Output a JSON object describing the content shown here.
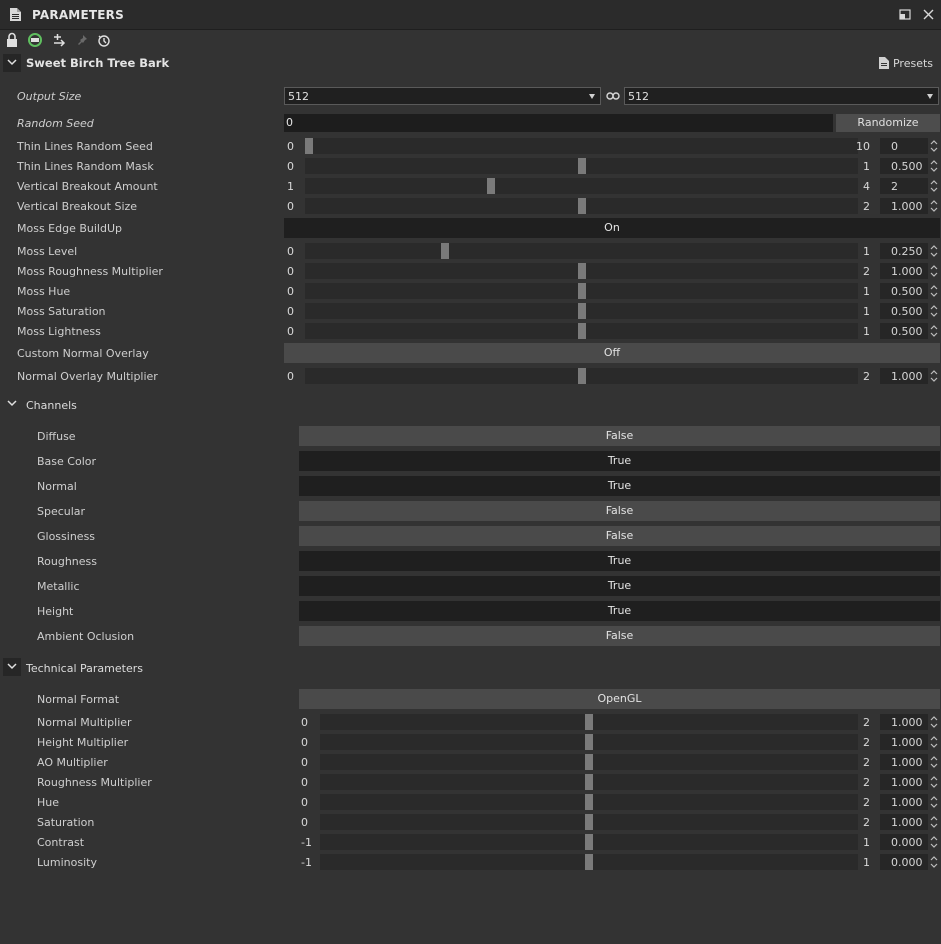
{
  "panel": {
    "title": "PARAMETERS"
  },
  "graph": {
    "title": "Sweet Birch Tree Bark",
    "presets_label": "Presets"
  },
  "output_size": {
    "label": "Output Size",
    "width": "512",
    "height": "512"
  },
  "random_seed": {
    "label": "Random Seed",
    "value": "0",
    "button": "Randomize"
  },
  "main_params": [
    {
      "label": "Thin Lines Random Seed",
      "min": "0",
      "max": "10",
      "value": "0",
      "fraction": 0.0
    },
    {
      "label": "Thin Lines Random Mask",
      "min": "0",
      "max": "1",
      "value": "0.500",
      "fraction": 0.5
    },
    {
      "label": "Vertical Breakout Amount",
      "min": "1",
      "max": "4",
      "value": "2",
      "fraction": 0.3333
    },
    {
      "label": "Vertical Breakout Size",
      "min": "0",
      "max": "2",
      "value": "1.000",
      "fraction": 0.5
    }
  ],
  "moss_edge": {
    "label": "Moss Edge BuildUp",
    "value": "On",
    "state": "on"
  },
  "moss_params": [
    {
      "label": "Moss Level",
      "min": "0",
      "max": "1",
      "value": "0.250",
      "fraction": 0.25
    },
    {
      "label": "Moss Roughness Multiplier",
      "min": "0",
      "max": "2",
      "value": "1.000",
      "fraction": 0.5
    },
    {
      "label": "Moss Hue",
      "min": "0",
      "max": "1",
      "value": "0.500",
      "fraction": 0.5
    },
    {
      "label": "Moss Saturation",
      "min": "0",
      "max": "1",
      "value": "0.500",
      "fraction": 0.5
    },
    {
      "label": "Moss Lightness",
      "min": "0",
      "max": "1",
      "value": "0.500",
      "fraction": 0.5
    }
  ],
  "custom_normal": {
    "label": "Custom Normal Overlay",
    "value": "Off",
    "state": "off"
  },
  "normal_overlay": {
    "label": "Normal Overlay Multiplier",
    "min": "0",
    "max": "2",
    "value": "1.000",
    "fraction": 0.5
  },
  "channels": {
    "title": "Channels",
    "items": [
      {
        "label": "Diffuse",
        "value": "False",
        "state": "off"
      },
      {
        "label": "Base Color",
        "value": "True",
        "state": "on"
      },
      {
        "label": "Normal",
        "value": "True",
        "state": "on"
      },
      {
        "label": "Specular",
        "value": "False",
        "state": "off"
      },
      {
        "label": "Glossiness",
        "value": "False",
        "state": "off"
      },
      {
        "label": "Roughness",
        "value": "True",
        "state": "on"
      },
      {
        "label": "Metallic",
        "value": "True",
        "state": "on"
      },
      {
        "label": "Height",
        "value": "True",
        "state": "on"
      },
      {
        "label": "Ambient Oclusion",
        "value": "False",
        "state": "off"
      }
    ]
  },
  "technical": {
    "title": "Technical Parameters",
    "normal_format": {
      "label": "Normal Format",
      "value": "OpenGL"
    },
    "items": [
      {
        "label": "Normal Multiplier",
        "min": "0",
        "max": "2",
        "value": "1.000",
        "fraction": 0.5
      },
      {
        "label": "Height Multiplier",
        "min": "0",
        "max": "2",
        "value": "1.000",
        "fraction": 0.5
      },
      {
        "label": "AO Multiplier",
        "min": "0",
        "max": "2",
        "value": "1.000",
        "fraction": 0.5
      },
      {
        "label": "Roughness Multiplier",
        "min": "0",
        "max": "2",
        "value": "1.000",
        "fraction": 0.5
      },
      {
        "label": "Hue",
        "min": "0",
        "max": "2",
        "value": "1.000",
        "fraction": 0.5
      },
      {
        "label": "Saturation",
        "min": "0",
        "max": "2",
        "value": "1.000",
        "fraction": 0.5
      },
      {
        "label": "Contrast",
        "min": "-1",
        "max": "1",
        "value": "0.000",
        "fraction": 0.5
      },
      {
        "label": "Luminosity",
        "min": "-1",
        "max": "1",
        "value": "0.000",
        "fraction": 0.5
      }
    ]
  },
  "icons": {
    "doc": "document-icon",
    "float": "float-window-icon",
    "close": "close-icon",
    "lock": "lock-icon",
    "sync": "sync-icon",
    "add": "add-link-icon",
    "pin": "pin-icon",
    "reset": "reset-icon",
    "link": "link-icon",
    "chevron": "chevron-down-icon"
  }
}
